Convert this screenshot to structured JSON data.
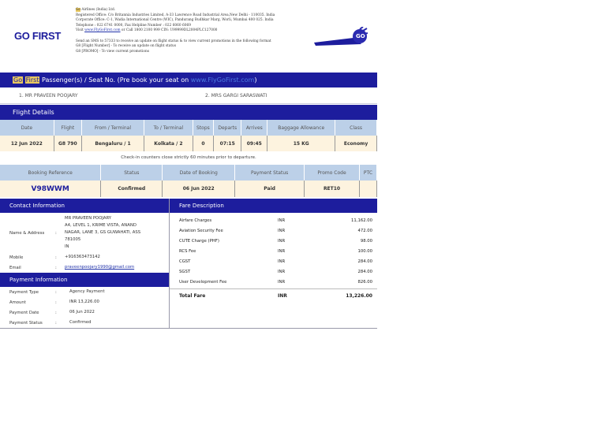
{
  "header": {
    "logo": "GO FIRST",
    "company_go": "Go",
    "company": " Airlines (India) Ltd.",
    "lines": [
      "Registered Office: C/o Britannia Industries Limited, A-33 Lawrence Road Industrial Area,New Delhi - 110035. India",
      "Corporate Office: C-1, Wadia International Centre (WIC), Pandurang Budhkar Marg, Worli, Mumbai 400 025. India",
      "Telephone : 022 6741 0000, Fax Helpline Number : 022 6060 6069"
    ],
    "visit": "Visit ",
    "site": "www.FlyGoFirst.com",
    "visit_rest": " or Call 1800 2100 999 CIN: U99999DL2004PLC127000",
    "sms": [
      "Send an SMS to 57333 to receive an update on flight status & to view current promotions in the following format",
      "G8 [Flight Number] - To receive an update on flight status",
      "G8 [PROMO] - To view current promotions"
    ]
  },
  "passengers": {
    "go": "Go",
    "first": "First",
    "title": " Passenger(s) / Seat No. (Pre book your seat on ",
    "link": "www.FlyGoFirst.com",
    "close": ")",
    "list": [
      "1. MR PRAVEEN POOJARY",
      "2. MRS GARGI SARASWATI"
    ]
  },
  "flight": {
    "title": "Flight Details",
    "headers": [
      "Date",
      "Flight",
      "From / Terminal",
      "To / Terminal",
      "Stops",
      "Departs",
      "Arrives",
      "Baggage Allowance",
      "Class"
    ],
    "row": [
      "12 Jun 2022",
      "G8 790",
      "Bengaluru / 1",
      "Kolkata / 2",
      "0",
      "07:15",
      "09:45",
      "15 KG",
      "Economy"
    ],
    "note": "Check-in counters close strictly 60 minutes prior to departure."
  },
  "booking": {
    "headers": [
      "Booking Reference",
      "Status",
      "Date of Booking",
      "Payment Status",
      "Promo Code",
      "PTC"
    ],
    "row": [
      "V98WWM",
      "Confirmed",
      "06 Jun 2022",
      "Paid",
      "RET10",
      ""
    ]
  },
  "contact": {
    "title": "Contact Information",
    "name_label": "Name & Address",
    "address": [
      "MR PRAVEEN POOJARY",
      "A4, LEVEL 1, KRIME VISTA, ANAND",
      "NAGAR, LANE 3, GS GUWAHATI, ASS",
      "781005",
      "IN"
    ],
    "mobile_label": "Mobile",
    "mobile": "+916363473142",
    "email_label": "Email",
    "email": "praveenpoojary1990@gmail.com",
    "sep": ":"
  },
  "payment": {
    "title": "Payment Information",
    "rows": [
      [
        "Payment Type",
        "Agency Payment"
      ],
      [
        "Amount",
        "INR 13,226.00"
      ],
      [
        "Payment Date",
        "06 Jun 2022"
      ],
      [
        "Payment Status",
        "Confirmed"
      ]
    ]
  },
  "fare": {
    "title": "Fare Description",
    "rows": [
      [
        "Airfare Charges",
        "INR",
        "11,162.00"
      ],
      [
        "Aviation Security Fee",
        "INR",
        "472.00"
      ],
      [
        "CUTE Charge (PHF)",
        "INR",
        "98.00"
      ],
      [
        "RCS Fee",
        "INR",
        "100.00"
      ],
      [
        "CGST",
        "INR",
        "284.00"
      ],
      [
        "SGST",
        "INR",
        "284.00"
      ],
      [
        "User Development Fee",
        "INR",
        "826.00"
      ]
    ],
    "total": [
      "Total Fare",
      "INR",
      "13,226.00"
    ]
  },
  "colors": {
    "brand": "#1d1d9d",
    "header_row": "#bcd0e8",
    "data_row": "#fdf3df"
  }
}
